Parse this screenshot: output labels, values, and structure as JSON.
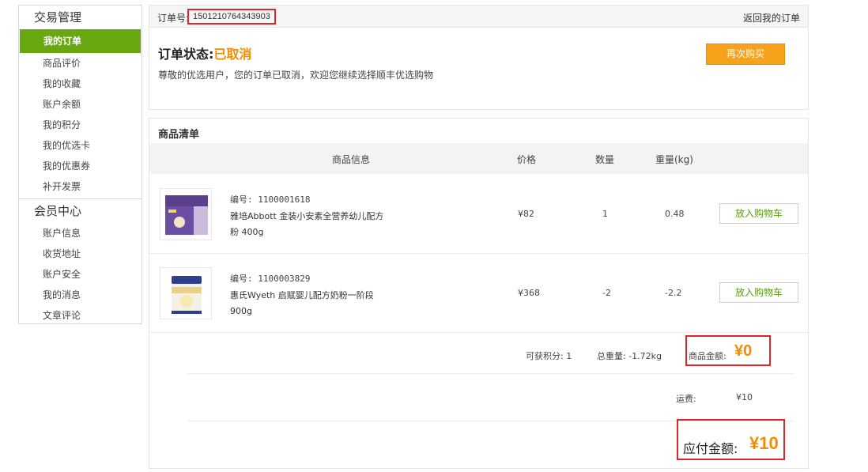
{
  "sidebar": {
    "section1": "交易管理",
    "items1": [
      "我的订单",
      "商品评价",
      "我的收藏",
      "账户余额",
      "我的积分",
      "我的优选卡",
      "我的优惠券",
      "补开发票"
    ],
    "section2": "会员中心",
    "items2": [
      "账户信息",
      "收货地址",
      "账户安全",
      "我的消息",
      "文章评论"
    ]
  },
  "order": {
    "label": "订单号:",
    "number": "1501210764343903",
    "back": "返回我的订单"
  },
  "status": {
    "title": "订单状态:",
    "value": "已取消",
    "desc": "尊敬的优选用户，您的订单已取消，欢迎您继续选择顺丰优选购物",
    "rebuy": "再次购买"
  },
  "goods": {
    "title": "商品清单",
    "headers": [
      "商品信息",
      "价格",
      "数量",
      "重量(kg)"
    ],
    "items": [
      {
        "id": "编号: 1100001618",
        "name": "雅培Abbott 金装小安素全营养幼儿配方粉 400g",
        "price": "¥82",
        "qty": "1",
        "weight": "0.48",
        "action": "放入购物车"
      },
      {
        "id": "编号: 1100003829",
        "name": "惠氏Wyeth 启赋婴儿配方奶粉一阶段 900g",
        "price": "¥368",
        "qty": "-2",
        "weight": "-2.2",
        "action": "放入购物车"
      }
    ]
  },
  "summary": {
    "points": "可获积分: 1",
    "total_weight": "总重量: -1.72kg",
    "goods_amount_label": "商品金额:",
    "goods_amount": "¥0",
    "shipping_label": "运费:",
    "shipping": "¥10",
    "payable_label": "应付金额:",
    "payable": "¥10"
  },
  "colors": {
    "accent_green": "#67a70f",
    "orange": "#f28c00",
    "highlight_red": "#e0262a"
  }
}
